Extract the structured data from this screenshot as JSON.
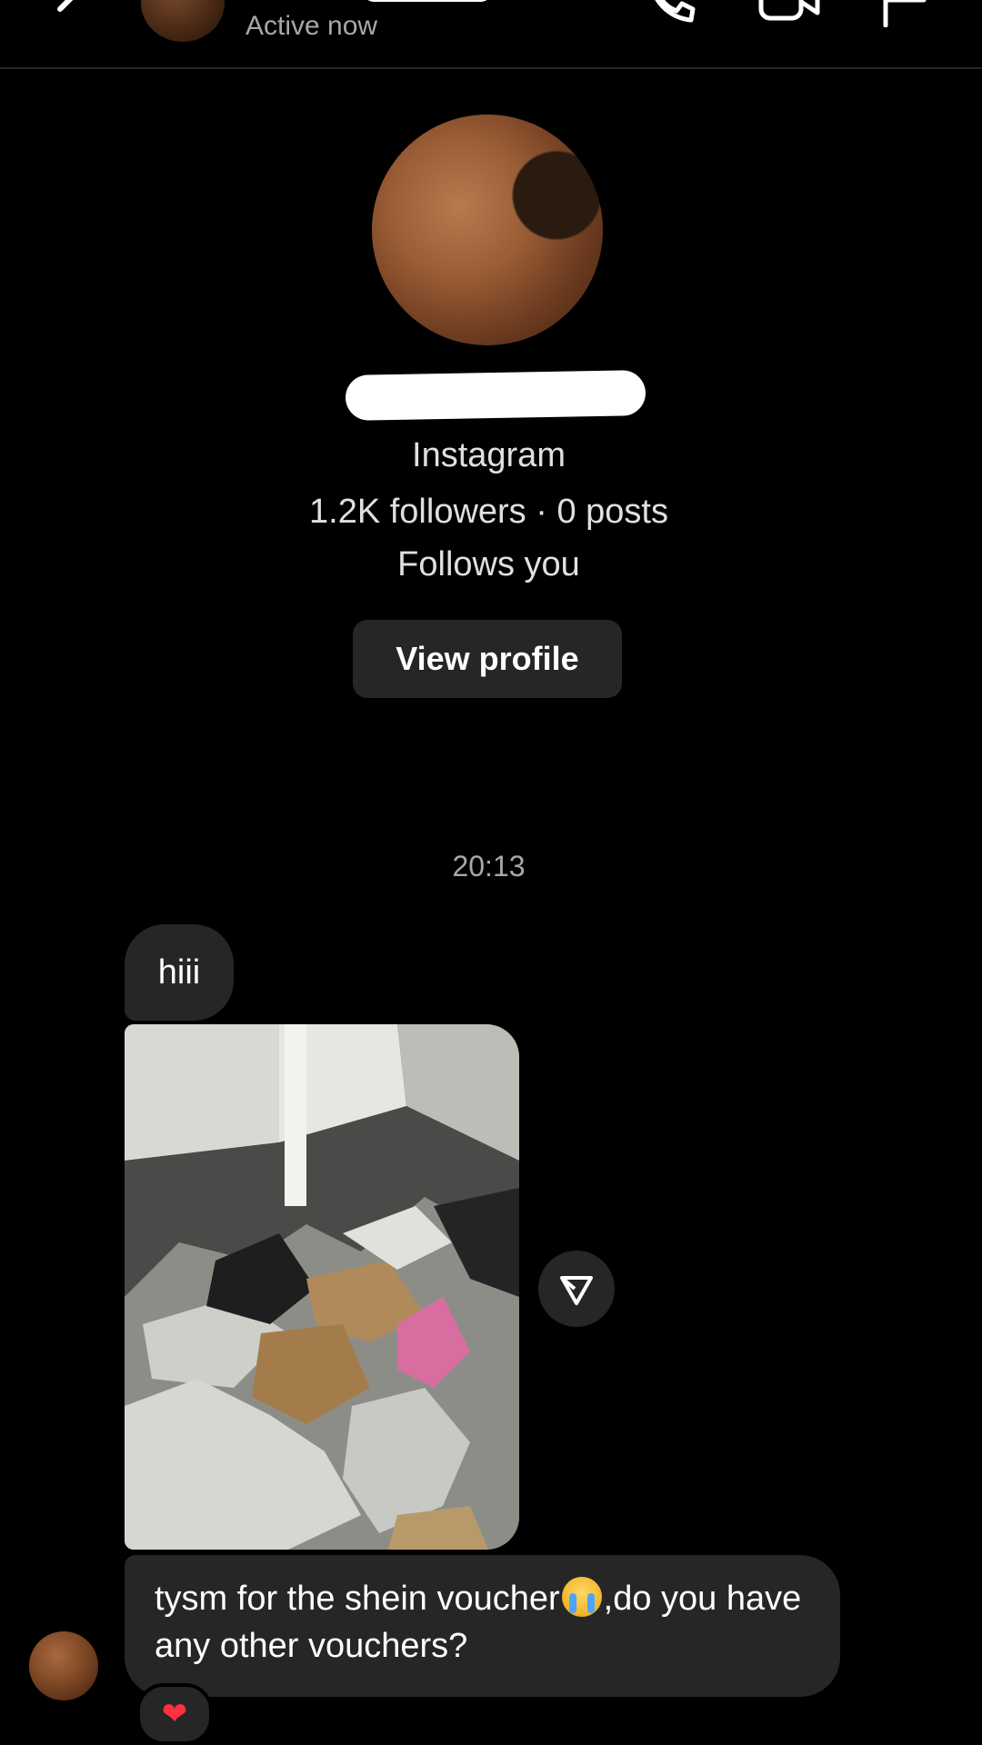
{
  "header": {
    "status": "Active now",
    "icons": [
      "back-icon",
      "phone-icon",
      "video-camera-icon",
      "flag-icon"
    ]
  },
  "profile": {
    "platform": "Instagram",
    "stats": "1.2K followers · 0 posts",
    "follows_you": "Follows you",
    "view_profile_label": "View profile"
  },
  "messages": {
    "timestamp": "20:13",
    "first": "hiii",
    "long_part1": "tysm for the shein voucher",
    "long_part2": ",do you have any other vouchers?",
    "reaction": "❤"
  },
  "colors": {
    "background": "#000000",
    "bubble": "#262626",
    "muted_text": "#a8a8a8",
    "heart": "#ff3040"
  }
}
